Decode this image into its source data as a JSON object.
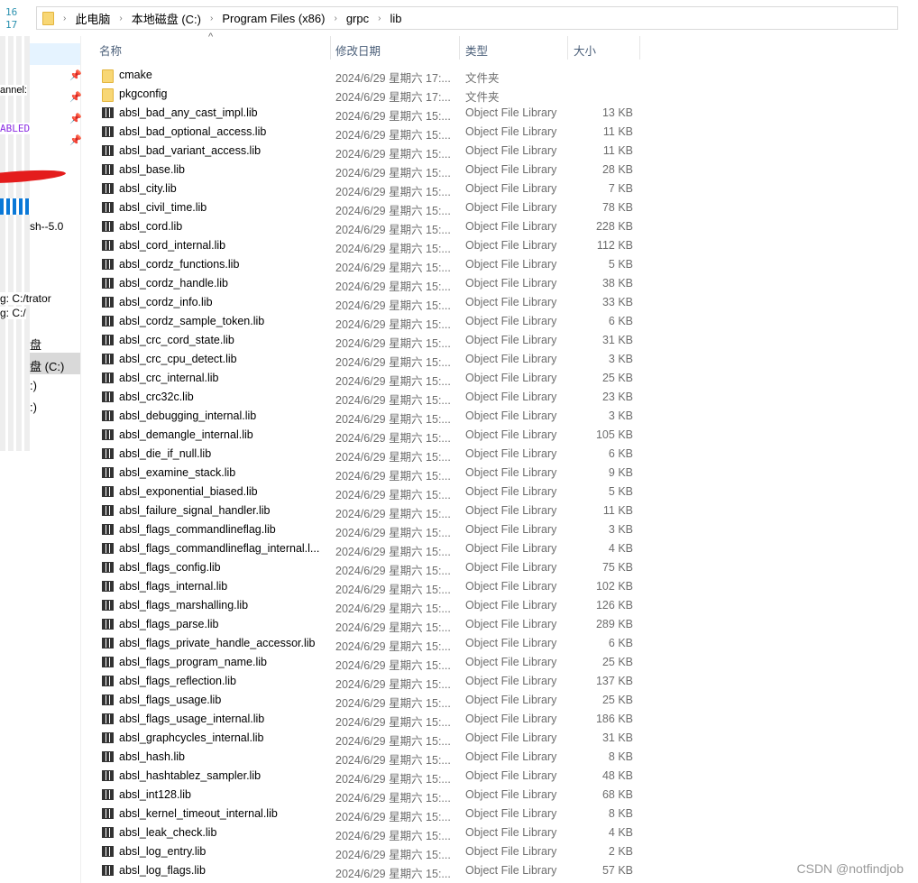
{
  "editor": {
    "line_numbers": [
      "16",
      "17"
    ],
    "fragments": [
      "annel:",
      "ABLED",
      "sh--5.0",
      "g: C:/trator",
      "g: C:/"
    ]
  },
  "address_bar": {
    "crumbs": [
      "此电脑",
      "本地磁盘 (C:)",
      "Program Files (x86)",
      "grpc",
      "lib"
    ]
  },
  "nav": {
    "items": [
      "盘",
      "盘 (C:)",
      ":)",
      ":)"
    ]
  },
  "columns": {
    "name": "名称",
    "date": "修改日期",
    "type": "类型",
    "size": "大小"
  },
  "files": [
    {
      "name": "cmake",
      "date": "2024/6/29 星期六 17:...",
      "type": "文件夹",
      "size": "",
      "icon": "folder"
    },
    {
      "name": "pkgconfig",
      "date": "2024/6/29 星期六 17:...",
      "type": "文件夹",
      "size": "",
      "icon": "folder"
    },
    {
      "name": "absl_bad_any_cast_impl.lib",
      "size": "13 KB"
    },
    {
      "name": "absl_bad_optional_access.lib",
      "size": "11 KB"
    },
    {
      "name": "absl_bad_variant_access.lib",
      "size": "11 KB"
    },
    {
      "name": "absl_base.lib",
      "size": "28 KB"
    },
    {
      "name": "absl_city.lib",
      "size": "7 KB"
    },
    {
      "name": "absl_civil_time.lib",
      "size": "78 KB"
    },
    {
      "name": "absl_cord.lib",
      "size": "228 KB"
    },
    {
      "name": "absl_cord_internal.lib",
      "size": "112 KB"
    },
    {
      "name": "absl_cordz_functions.lib",
      "size": "5 KB"
    },
    {
      "name": "absl_cordz_handle.lib",
      "size": "38 KB"
    },
    {
      "name": "absl_cordz_info.lib",
      "size": "33 KB"
    },
    {
      "name": "absl_cordz_sample_token.lib",
      "size": "6 KB"
    },
    {
      "name": "absl_crc_cord_state.lib",
      "size": "31 KB"
    },
    {
      "name": "absl_crc_cpu_detect.lib",
      "size": "3 KB"
    },
    {
      "name": "absl_crc_internal.lib",
      "size": "25 KB"
    },
    {
      "name": "absl_crc32c.lib",
      "size": "23 KB"
    },
    {
      "name": "absl_debugging_internal.lib",
      "size": "3 KB"
    },
    {
      "name": "absl_demangle_internal.lib",
      "size": "105 KB"
    },
    {
      "name": "absl_die_if_null.lib",
      "size": "6 KB"
    },
    {
      "name": "absl_examine_stack.lib",
      "size": "9 KB"
    },
    {
      "name": "absl_exponential_biased.lib",
      "size": "5 KB"
    },
    {
      "name": "absl_failure_signal_handler.lib",
      "size": "11 KB"
    },
    {
      "name": "absl_flags_commandlineflag.lib",
      "size": "3 KB"
    },
    {
      "name": "absl_flags_commandlineflag_internal.l...",
      "size": "4 KB"
    },
    {
      "name": "absl_flags_config.lib",
      "size": "75 KB"
    },
    {
      "name": "absl_flags_internal.lib",
      "size": "102 KB"
    },
    {
      "name": "absl_flags_marshalling.lib",
      "size": "126 KB"
    },
    {
      "name": "absl_flags_parse.lib",
      "size": "289 KB"
    },
    {
      "name": "absl_flags_private_handle_accessor.lib",
      "size": "6 KB"
    },
    {
      "name": "absl_flags_program_name.lib",
      "size": "25 KB"
    },
    {
      "name": "absl_flags_reflection.lib",
      "size": "137 KB"
    },
    {
      "name": "absl_flags_usage.lib",
      "size": "25 KB"
    },
    {
      "name": "absl_flags_usage_internal.lib",
      "size": "186 KB"
    },
    {
      "name": "absl_graphcycles_internal.lib",
      "size": "31 KB"
    },
    {
      "name": "absl_hash.lib",
      "size": "8 KB"
    },
    {
      "name": "absl_hashtablez_sampler.lib",
      "size": "48 KB"
    },
    {
      "name": "absl_int128.lib",
      "size": "68 KB"
    },
    {
      "name": "absl_kernel_timeout_internal.lib",
      "size": "8 KB"
    },
    {
      "name": "absl_leak_check.lib",
      "size": "4 KB"
    },
    {
      "name": "absl_log_entry.lib",
      "size": "2 KB"
    },
    {
      "name": "absl_log_flags.lib",
      "size": "57 KB"
    }
  ],
  "lib_defaults": {
    "date": "2024/6/29 星期六 15:...",
    "type": "Object File Library",
    "icon": "library"
  },
  "watermark": "CSDN @notfindjob"
}
